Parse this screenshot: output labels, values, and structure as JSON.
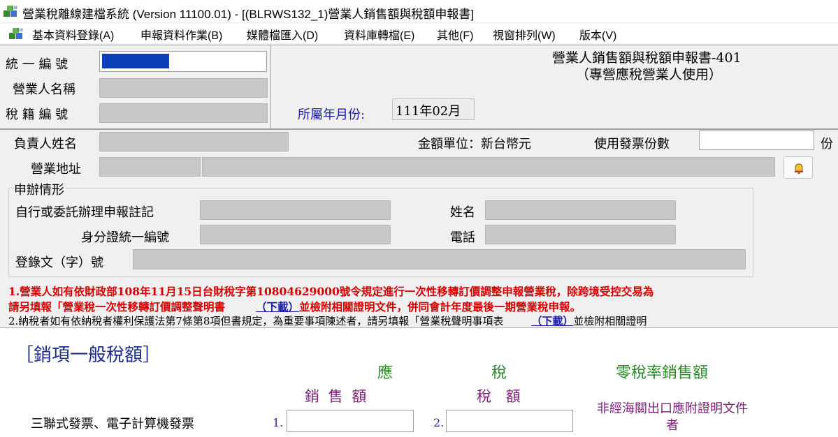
{
  "window": {
    "title": "營業稅離線建檔系統 (Version 11100.01) - [(BLRWS132_1)營業人銷售額與稅額申報書]"
  },
  "menu": {
    "items": [
      {
        "label": "基本資料登錄(A)"
      },
      {
        "label": "申報資料作業(B)"
      },
      {
        "label": "媒體檔匯入(D)"
      },
      {
        "label": "資料庫轉檔(E)"
      },
      {
        "label": "其他(F)"
      },
      {
        "label": "視窗排列(W)"
      },
      {
        "label": "版本(V)"
      }
    ]
  },
  "header": {
    "unified_no_label": "統 一 編 號",
    "business_name_label": "營業人名稱",
    "tax_reg_no_label": "稅 籍 編 號",
    "form_title": "營業人銷售額與稅額申報書-401",
    "form_subtitle": "（專營應稅營業人使用）",
    "period_label": "所屬年月份:",
    "period_value": "111年02月"
  },
  "details": {
    "owner_label": "負責人姓名",
    "currency_label": "金額單位：新台幣元",
    "invoice_count_label": "使用發票份數",
    "invoice_unit": "份",
    "address_label": "營業地址"
  },
  "filing": {
    "group_label": "申辦情形",
    "agent_note_label": "自行或委託辦理申報註記",
    "id_label": "身分證統一編號",
    "name_label": "姓名",
    "phone_label": "電話",
    "reg_doc_label": "登錄文（字）號"
  },
  "notes": {
    "note1_line1": "1.營業人如有依財政部108年11月15日台財稅字第10804629000號令規定進行一次性移轉訂價調整申報營業稅，除跨境受控交易為",
    "note1_line2_a": "  請另填報「營業稅一次性移轉訂價調整聲明書",
    "note1_download": "（下載）",
    "note1_line2_b": "並檢附相關證明文件，併同會計年度最後一期營業稅申報。",
    "note2_a": "2.納稅者如有依納稅者權利保護法第7條第8項但書規定，為重要事項陳述者，請另填報「營業稅聲明事項表",
    "note2_download": "（下載）",
    "note2_b": "並檢附相關證明"
  },
  "sales": {
    "section_title": "［銷項一般稅額］",
    "taxable_head": "應",
    "tax_head": "稅",
    "zero_rate_head": "零稅率銷售額",
    "sales_amount_head": "銷 售 額",
    "tax_amount_head": "稅 額",
    "row1_label": "三聯式發票、電子計算機發票",
    "row1_no1": "1.",
    "row1_no2": "2.",
    "zero_rate_note": "非經海關出口應附證明文件者"
  },
  "colors": {
    "selection_blue": "#0a3fb8",
    "field_gray": "#c8c8c8",
    "note_red": "#d40000",
    "link_blue": "#1a1aa6"
  }
}
